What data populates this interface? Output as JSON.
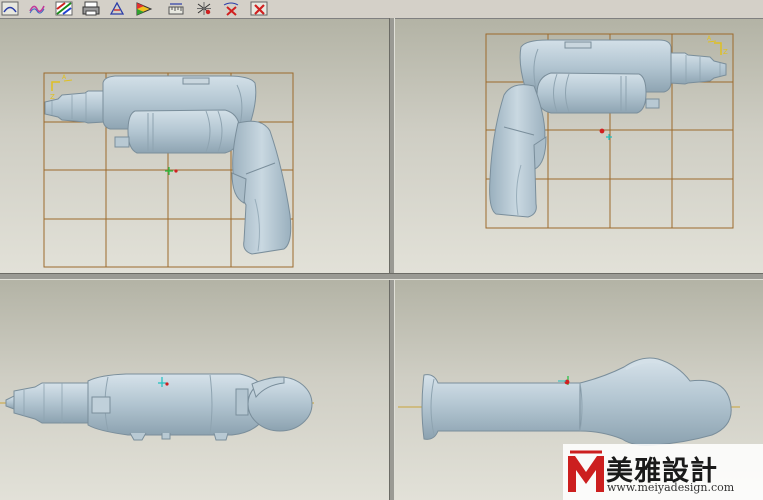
{
  "toolbar": {
    "icons": [
      "curve-icon",
      "surface-icon",
      "color-swatch-icon",
      "print-icon",
      "analysis-icon",
      "paint-icon",
      "measure-icon",
      "mesh-icon",
      "delete-mesh-icon",
      "delete-icon"
    ]
  },
  "viewports": {
    "top_left": {
      "csys_label": "Z",
      "csys_sub": "A"
    },
    "top_right": {
      "csys_label": "Z",
      "csys_sub": "A"
    }
  },
  "colors": {
    "model": "#b7c8d3",
    "grid": "#9c6a2c",
    "axis": "#c9a43a",
    "background_top": "#b3b3a5",
    "background_bottom": "#e2e1d8",
    "watermark_red": "#cc1f1f"
  },
  "watermark": {
    "title": "美雅設計",
    "url": "www.meiyadesign.com"
  }
}
